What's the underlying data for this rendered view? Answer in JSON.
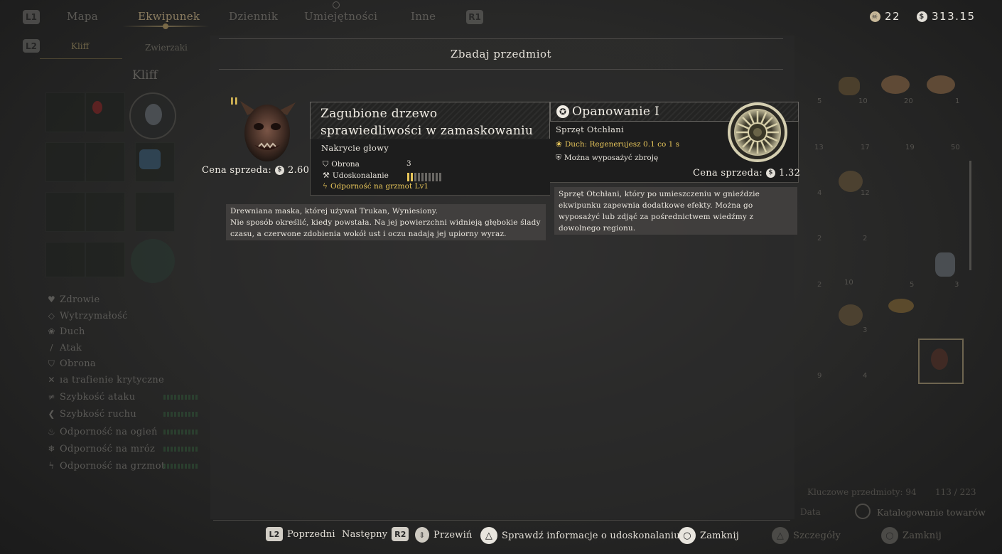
{
  "nav": {
    "l1": "L1",
    "r1": "R1",
    "l2": "L2",
    "tabs": [
      "Mapa",
      "Ekwipunek",
      "Dziennik",
      "Umiejętności",
      "Inne"
    ],
    "subtabs": [
      "Kliff",
      "Zwierzaki"
    ],
    "character": "Kliff"
  },
  "currency": {
    "small": "22",
    "coins": "313.15"
  },
  "stats": [
    {
      "label": "Zdrowie",
      "icon": "heart-icon"
    },
    {
      "label": "Wytrzymałość",
      "icon": "diamond-icon"
    },
    {
      "label": "Duch",
      "icon": "lotus-icon"
    },
    {
      "label": "Atak",
      "icon": "sword-icon"
    },
    {
      "label": "Obrona",
      "icon": "shield-icon"
    },
    {
      "label": "ıa trafienie krytyczne",
      "icon": "crit-icon"
    },
    {
      "label": "Szybkość ataku",
      "icon": "attack-speed-icon"
    },
    {
      "label": "Szybkość ruchu",
      "icon": "move-speed-icon"
    },
    {
      "label": "Odporność na ogień",
      "icon": "fire-icon"
    },
    {
      "label": "Odporność na mróz",
      "icon": "frost-icon"
    },
    {
      "label": "Odporność na grzmot",
      "icon": "thunder-icon"
    }
  ],
  "grid_counts": [
    "5",
    "10",
    "20",
    "1",
    "13",
    "17",
    "19",
    "50",
    "4",
    "12",
    "2",
    "2",
    "2",
    "10",
    "5",
    "3",
    "3",
    "9",
    "4"
  ],
  "footer_info": {
    "key_items": "Kluczowe przedmioty: 94",
    "capacity": "113 / 223",
    "sort": "Data",
    "catalog": "Katalogowanie towarów",
    "details": "Szczegóły",
    "close_bg": "Zamknij"
  },
  "modal": {
    "title": "Zbadaj przedmiot",
    "left": {
      "tier": "II",
      "name": "Zagubione drzewo sprawiedliwości w zamaskowaniu",
      "type": "Nakrycie głowy",
      "price_label": "Cena sprzeda:",
      "price": "2.60",
      "stats": [
        {
          "label": "Obrona",
          "value": "3",
          "icon": "shield-icon"
        },
        {
          "label": "Udoskonalanie",
          "value": "",
          "icon": "refine-icon"
        }
      ],
      "refine_level": 0.2,
      "special": "Odporność na grzmot Lv1",
      "description_lines": [
        "Drewniana maska, której używał Trukan, Wyniesiony.",
        "Nie sposób określić, kiedy powstała. Na jej powierzchni widnieją głębokie ślady",
        "czasu, a czerwone zdobienia wokół ust i oczu nadają jej upiorny wyraz."
      ]
    },
    "right": {
      "name": "Opanowanie I",
      "type": "Sprzęt Otchłani",
      "effect": "Duch: Regenerujesz 0.1 co 1 s",
      "equip_note": "Można wyposażyć zbroję",
      "price_label": "Cena sprzeda:",
      "price": "1.32",
      "description_lines": [
        "Sprzęt Otchłani, który po umieszczeniu w gnieździe",
        "ekwipunku zapewnia dodatkowe efekty. Można go",
        "wyposażyć lub zdjąć za pośrednictwem wiedźmy z",
        "dowolnego regionu."
      ]
    }
  },
  "prompts": {
    "prev_btn": "L2",
    "prev": "Poprzedni",
    "next": "Następny",
    "next_btn": "R2",
    "scroll": "Przewiń",
    "check_btn": "△",
    "check": "Sprawdź informacje o udoskonalaniu",
    "close_btn": "○",
    "close": "Zamknij"
  },
  "colors": {
    "accent_gold": "#e8c65a",
    "panel_border": "#6a6864",
    "desc_bg": "#4a4846"
  }
}
